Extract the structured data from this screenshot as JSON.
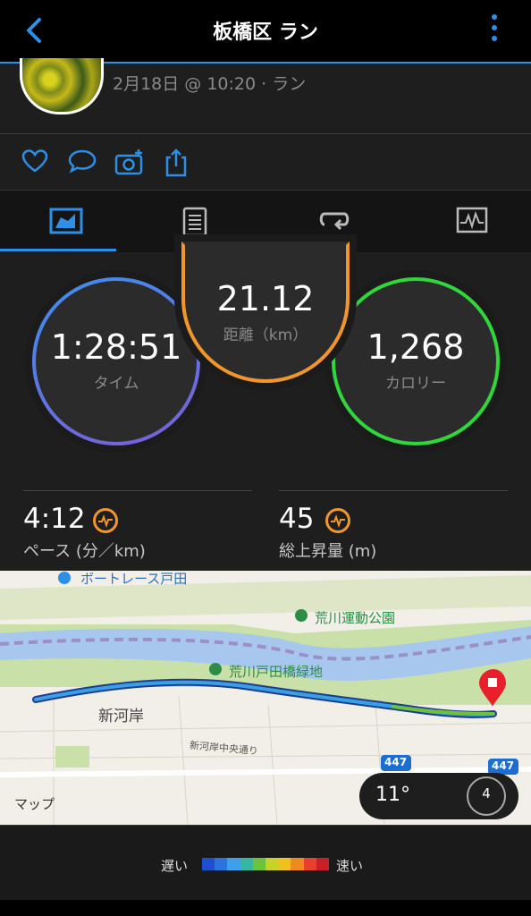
{
  "header": {
    "title": "板橋区 ラン",
    "back_icon": "chevron-left-icon",
    "more_icon": "vertical-dots-icon"
  },
  "activity": {
    "subtitle": "2月18日 @ 10:20 · ラン"
  },
  "social": {
    "icons": [
      "heart-icon",
      "comment-icon",
      "camera-add-icon",
      "share-icon"
    ]
  },
  "tabs": {
    "icons": [
      "summary-chart-icon",
      "details-list-icon",
      "laps-icon",
      "graph-icon"
    ],
    "selected": 0
  },
  "stats": {
    "time": {
      "value": "1:28:51",
      "label": "タイム"
    },
    "distance": {
      "value": "21.12",
      "label": "距離（km）"
    },
    "calories": {
      "value": "1,268",
      "label": "カロリー"
    },
    "pace": {
      "value": "4:12",
      "label": "ペース (分／km)"
    },
    "ascent": {
      "value": "45",
      "label": "総上昇量 (m)"
    }
  },
  "map": {
    "labels": {
      "boatrace": "ボートレース戸田",
      "park1": "荒川運動公園",
      "park2": "荒川戸田橋緑地",
      "district": "新河岸",
      "street": "新河岸中央通り",
      "route1": "447",
      "route2": "447",
      "apple_maps": "マップ"
    },
    "temperature": "11°",
    "wind": "4"
  },
  "legend": {
    "slow": "遅い",
    "fast": "速い",
    "colors": [
      "#1f4fcf",
      "#2b74e0",
      "#3ea0ea",
      "#36b7a0",
      "#6cc23a",
      "#c8d02a",
      "#f0c020",
      "#f08a20",
      "#e8402c",
      "#c8202a"
    ]
  }
}
